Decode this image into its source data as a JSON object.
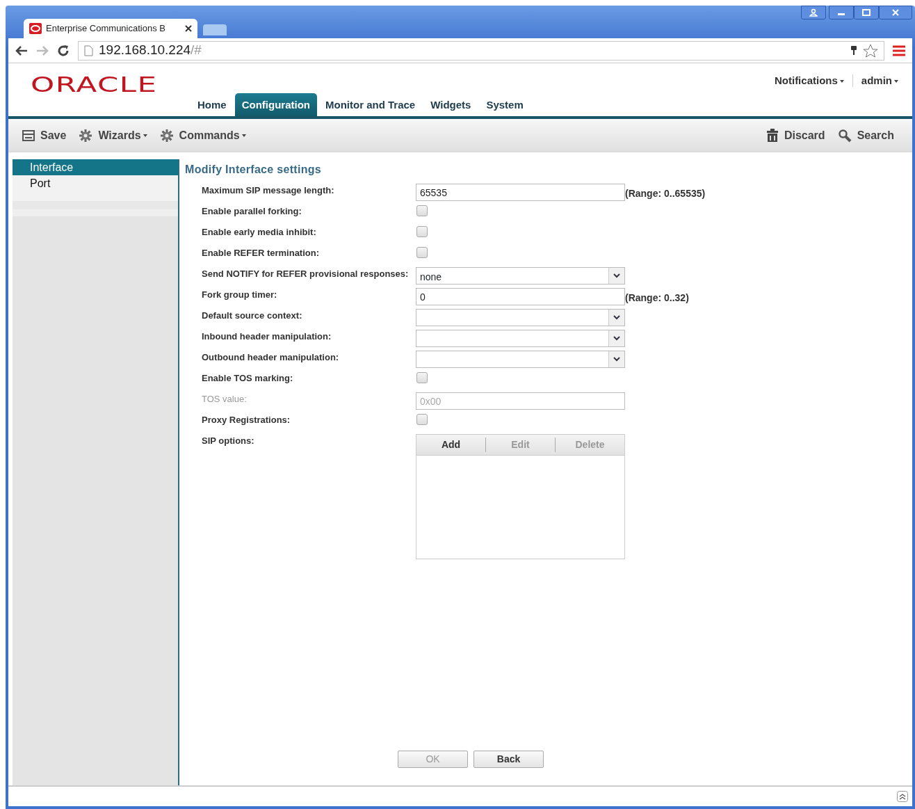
{
  "browser": {
    "tab_title": "Enterprise Communications B",
    "url": "192.168.10.224",
    "url_suffix": "/#"
  },
  "header": {
    "logo": "ORACLE",
    "user_menu": [
      {
        "label": "Notifications"
      },
      {
        "label": "admin"
      }
    ],
    "nav": [
      {
        "label": "Home",
        "selected": false
      },
      {
        "label": "Configuration",
        "selected": true
      },
      {
        "label": "Monitor and Trace",
        "selected": false
      },
      {
        "label": "Widgets",
        "selected": false
      },
      {
        "label": "System",
        "selected": false
      }
    ]
  },
  "toolbar": {
    "left": [
      {
        "label": "Save",
        "dropdown": false
      },
      {
        "label": "Wizards",
        "dropdown": true
      },
      {
        "label": "Commands",
        "dropdown": true
      }
    ],
    "right": [
      {
        "label": "Discard",
        "dropdown": false
      },
      {
        "label": "Search",
        "dropdown": false
      }
    ]
  },
  "sidebar": {
    "items": [
      {
        "label": "Interface",
        "selected": true
      },
      {
        "label": "Port",
        "selected": false
      }
    ]
  },
  "form": {
    "title": "Modify Interface settings",
    "fields": [
      {
        "kind": "text",
        "label": "Maximum SIP message length:",
        "value": "65535",
        "range": "(Range: 0..65535)",
        "disabled": false
      },
      {
        "kind": "checkbox",
        "label": "Enable parallel forking:",
        "checked": false,
        "disabled": false
      },
      {
        "kind": "checkbox",
        "label": "Enable early media inhibit:",
        "checked": false,
        "disabled": false
      },
      {
        "kind": "checkbox",
        "label": "Enable REFER termination:",
        "checked": false,
        "disabled": false
      },
      {
        "kind": "select",
        "label": "Send NOTIFY for REFER provisional responses:",
        "value": "none",
        "disabled": false
      },
      {
        "kind": "text",
        "label": "Fork group timer:",
        "value": "0",
        "range": "(Range: 0..32)",
        "disabled": false
      },
      {
        "kind": "select",
        "label": "Default source context:",
        "disabled": false
      },
      {
        "kind": "select",
        "label": "Inbound header manipulation:",
        "disabled": false
      },
      {
        "kind": "select",
        "label": "Outbound header manipulation:",
        "disabled": false
      },
      {
        "kind": "checkbox",
        "label": "Enable TOS marking:",
        "checked": false,
        "disabled": false
      },
      {
        "kind": "text",
        "label": "TOS value:",
        "value": "0x00",
        "disabled": true
      },
      {
        "kind": "checkbox",
        "label": "Proxy Registrations:",
        "checked": false,
        "disabled": false
      },
      {
        "kind": "list",
        "label": "SIP options:",
        "disabled": false,
        "buttons": [
          {
            "label": "Add",
            "disabled": false
          },
          {
            "label": "Edit",
            "disabled": true
          },
          {
            "label": "Delete",
            "disabled": true
          }
        ]
      }
    ]
  },
  "footer_buttons": [
    {
      "label": "OK",
      "disabled": true
    },
    {
      "label": "Back",
      "disabled": false
    }
  ]
}
